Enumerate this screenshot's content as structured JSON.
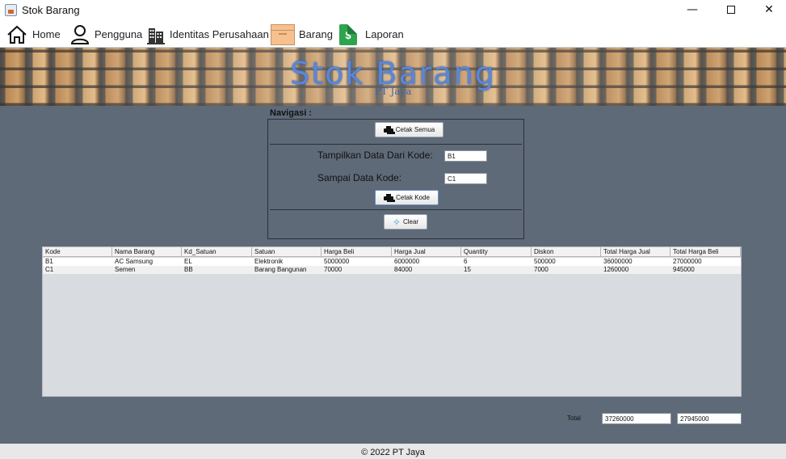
{
  "window": {
    "title": "Stok Barang",
    "minimize": "—",
    "close": "✕"
  },
  "menu": {
    "home": "Home",
    "pengguna": "Pengguna",
    "identitas": "Identitas Perusahaan",
    "barang": "Barang",
    "laporan": "Laporan"
  },
  "banner": {
    "title": "Stok Barang",
    "subtitle": "PT Jaya"
  },
  "navigation": {
    "label": "Navigasi :",
    "cetak_semua": "Cetak Semua",
    "dari_kode_label": "Tampilkan Data Dari Kode:",
    "dari_kode_value": "B1",
    "sampai_kode_label": "Sampai Data Kode:",
    "sampai_kode_value": "C1",
    "cetak_kode": "Cetak Kode",
    "clear": "Clear"
  },
  "table": {
    "columns": [
      "Kode",
      "Nama Barang",
      "Kd_Satuan",
      "Satuan",
      "Harga Beli",
      "Harga Jual",
      "Quantity",
      "Diskon",
      "Total Harga Jual",
      "Total Harga Beli"
    ],
    "rows": [
      [
        "B1",
        "AC Samsung",
        "EL",
        "Elektronik",
        "5000000",
        "6000000",
        "6",
        "500000",
        "36000000",
        "27000000"
      ],
      [
        "C1",
        "Semen",
        "BB",
        "Barang Bangunan",
        "70000",
        "84000",
        "15",
        "7000",
        "1260000",
        "945000"
      ]
    ]
  },
  "totals": {
    "label": "Total",
    "total_harga_jual": "37260000",
    "total_harga_beli": "27945000"
  },
  "footer": {
    "text": "© 2022 PT Jaya"
  }
}
